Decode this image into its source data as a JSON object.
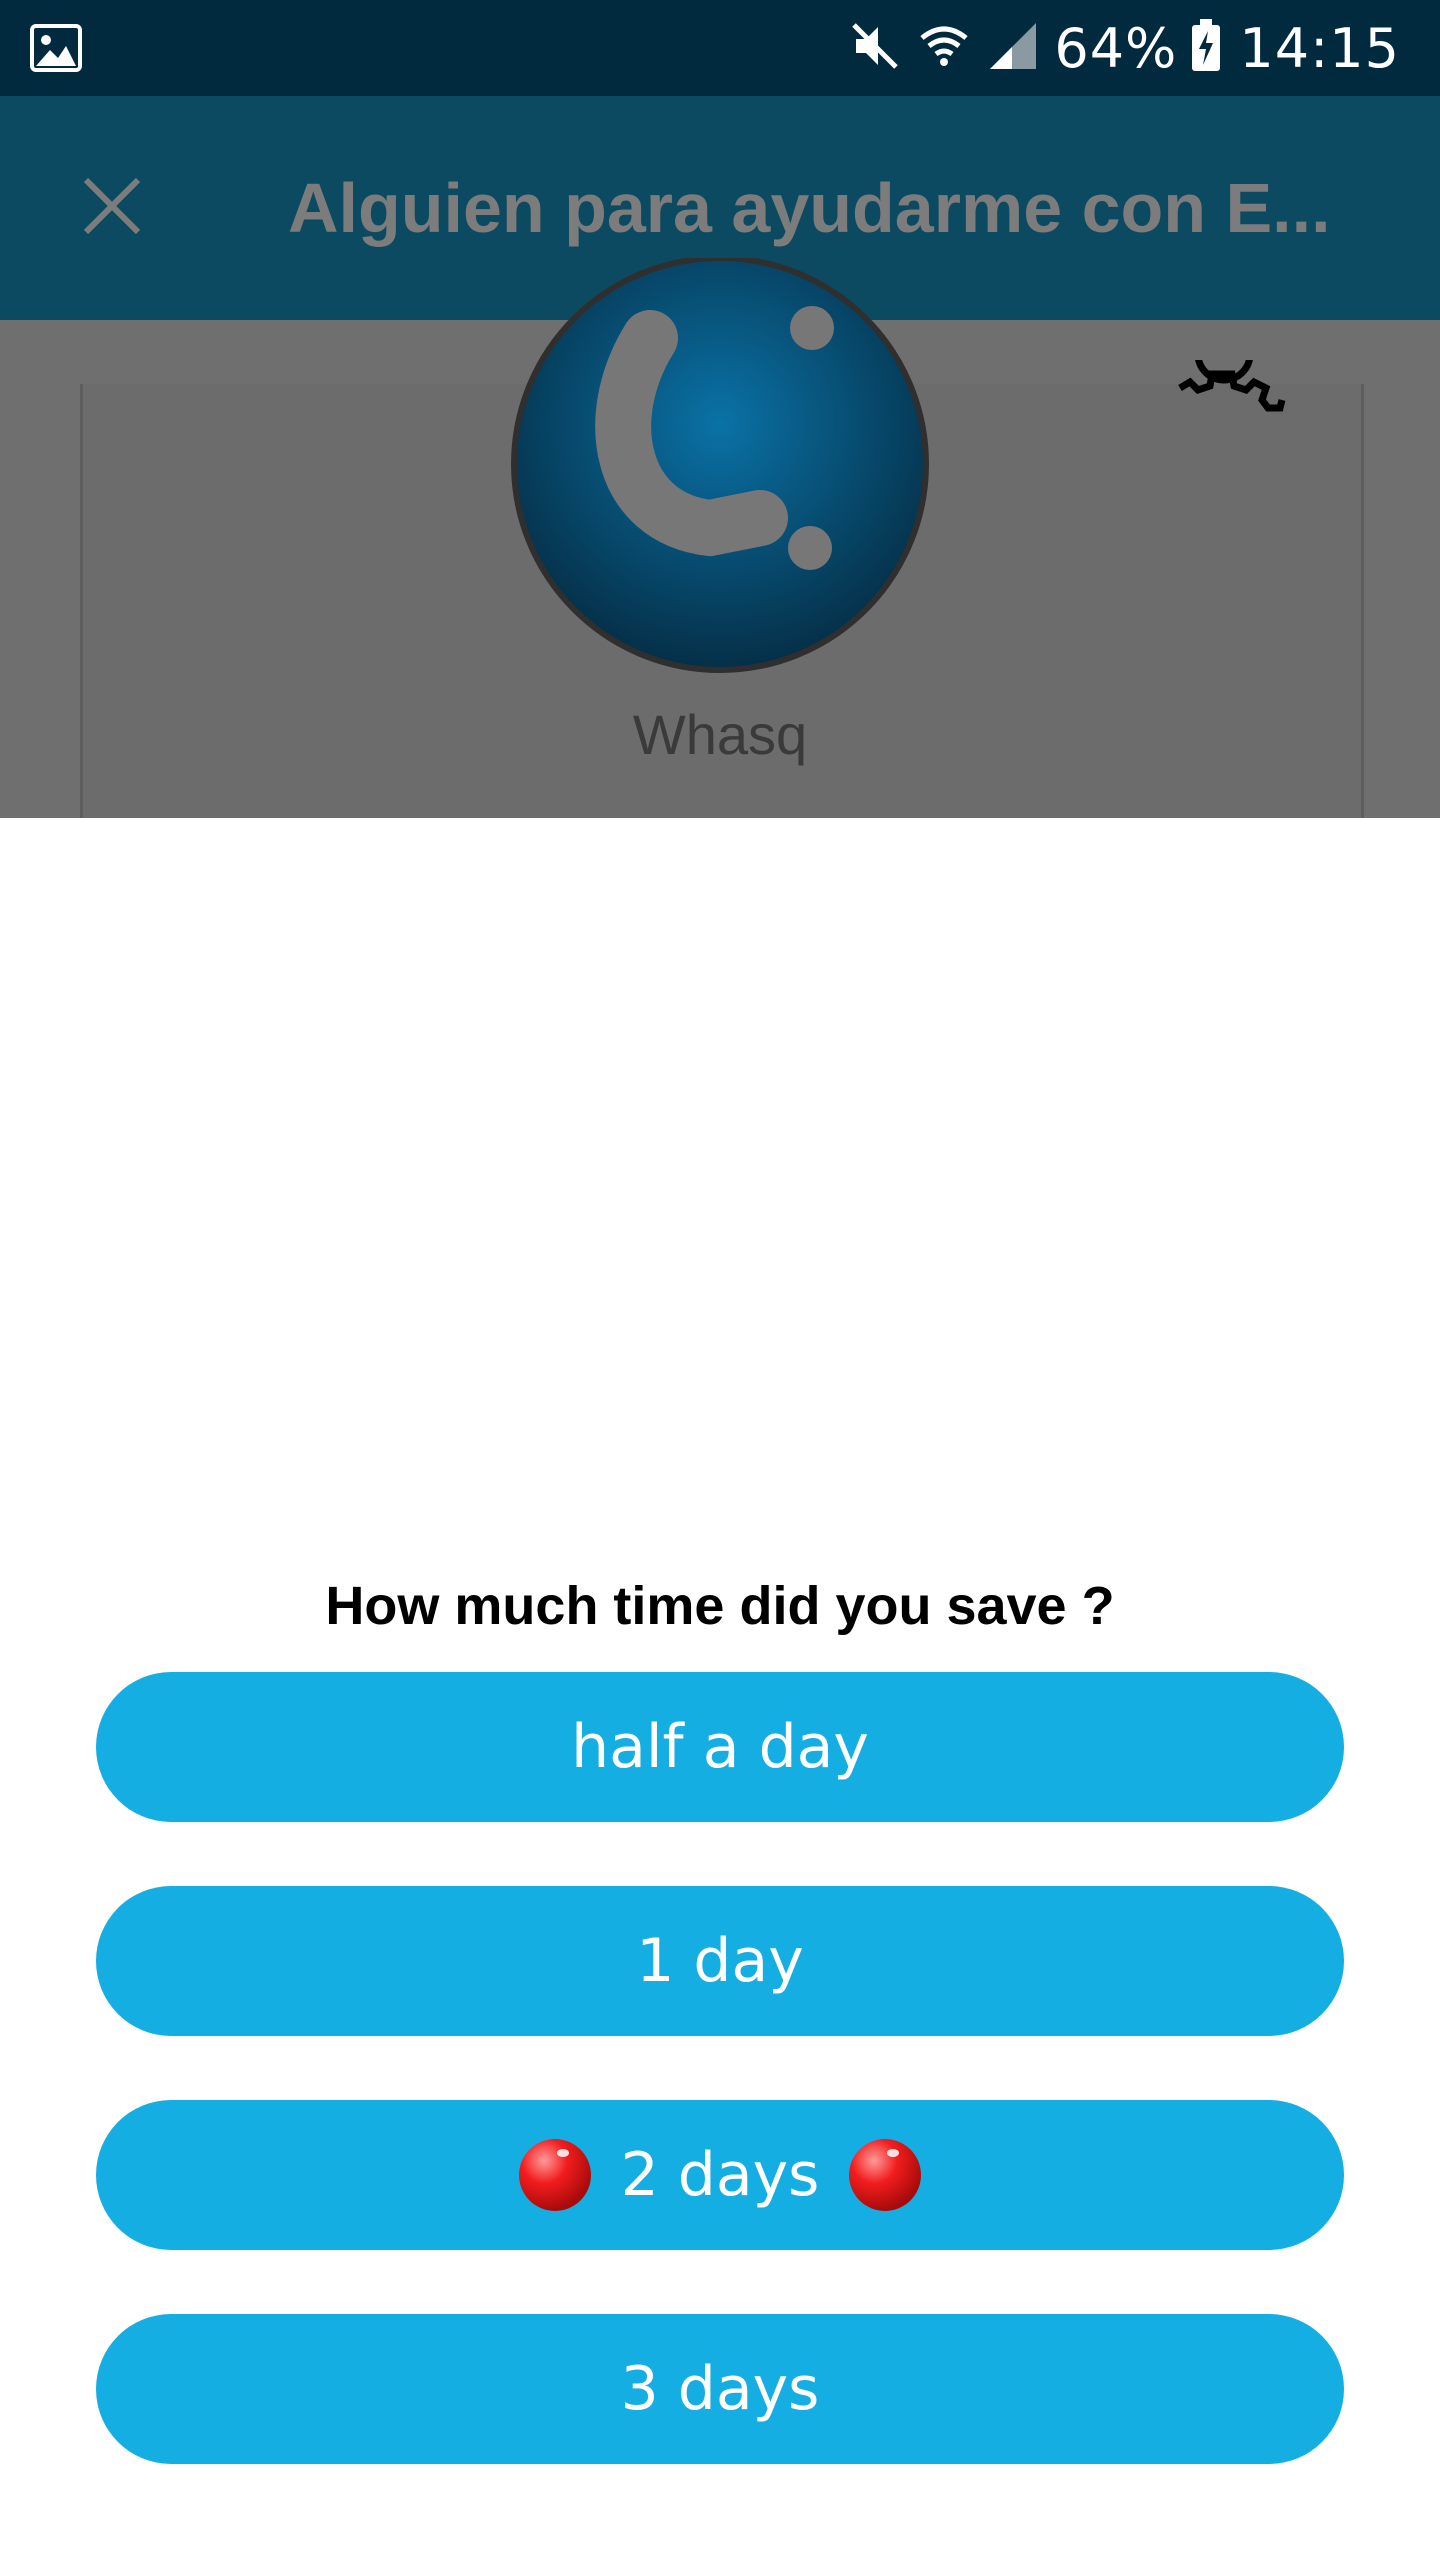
{
  "status_bar": {
    "battery_percent": "64%",
    "time": "14:15",
    "icons": [
      "gallery-icon",
      "mute-icon",
      "wifi-icon",
      "signal-icon",
      "battery-charging-icon"
    ]
  },
  "toolbar": {
    "close_icon": "close-icon",
    "title": "Alguien para ayudarme con E..."
  },
  "profile": {
    "name": "Whasq",
    "settings_icon": "gear-icon"
  },
  "dialog": {
    "question": "How much time did you save ?",
    "options": [
      {
        "label": "half a day"
      },
      {
        "label": "1 day"
      },
      {
        "label": "2 days",
        "icon": "red-ball-icon"
      },
      {
        "label": "3 days"
      }
    ]
  },
  "colors": {
    "status_bar": "#012a3e",
    "toolbar": "#0c4a61",
    "overlay": "#6f6f6f",
    "button": "#15aee3",
    "logo": "#0b7fb3"
  }
}
